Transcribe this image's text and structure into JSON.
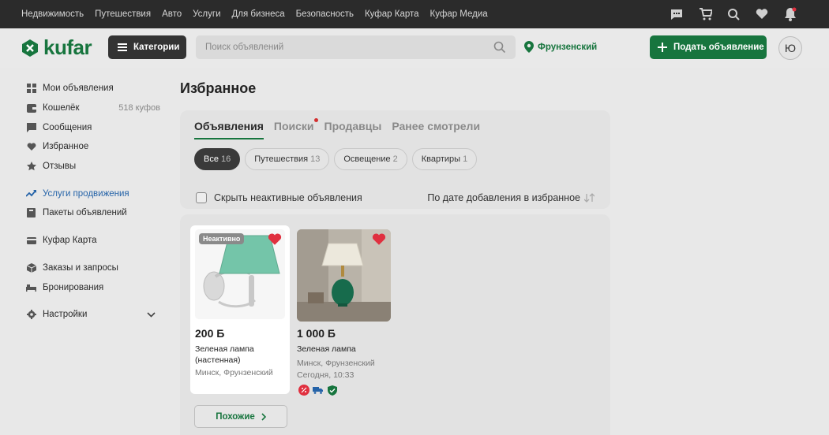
{
  "topnav": {
    "links": [
      "Недвижимость",
      "Путешествия",
      "Авто",
      "Услуги",
      "Для бизнеса",
      "Безопасность",
      "Куфар Карта",
      "Куфар Медиа"
    ],
    "icons": [
      "chat-icon",
      "cart-icon",
      "search-history-icon",
      "heart-icon",
      "bell-icon"
    ]
  },
  "header": {
    "logo_text": "kufar",
    "categories_label": "Категории",
    "search_placeholder": "Поиск объявлений",
    "region": "Фрунзенский",
    "post_button": "Подать объявление",
    "avatar_letter": "Ю"
  },
  "sidebar": {
    "items": [
      {
        "label": "Мои объявления",
        "icon": "grid-icon"
      },
      {
        "label": "Кошелёк",
        "meta": "518 куфов",
        "icon": "wallet-icon"
      },
      {
        "label": "Сообщения",
        "icon": "message-icon"
      },
      {
        "label": "Избранное",
        "icon": "heart-icon"
      },
      {
        "label": "Отзывы",
        "icon": "star-icon"
      },
      {
        "label": "Услуги продвижения",
        "icon": "trend-icon",
        "active": true
      },
      {
        "label": "Пакеты объявлений",
        "icon": "package-icon"
      },
      {
        "label": "Куфар Карта",
        "icon": "card-icon"
      },
      {
        "label": "Заказы и запросы",
        "icon": "box-icon"
      },
      {
        "label": "Бронирования",
        "icon": "bed-icon"
      },
      {
        "label": "Настройки",
        "icon": "gear-icon"
      }
    ]
  },
  "main": {
    "title": "Избранное",
    "tabs": [
      "Объявления",
      "Поиски",
      "Продавцы",
      "Ранее смотрели"
    ],
    "chips": [
      {
        "label": "Все",
        "count": "16"
      },
      {
        "label": "Путешествия",
        "count": "13"
      },
      {
        "label": "Освещение",
        "count": "2"
      },
      {
        "label": "Квартиры",
        "count": "1"
      }
    ],
    "hide_inactive": "Скрыть неактивные объявления",
    "sort_label": "По дате добавления в избранное",
    "listings": [
      {
        "badge": "Неактивно",
        "price": "200 Б",
        "title_line1": "Зеленая лампа",
        "title_line2": "(настенная)",
        "location": "Минск, Фрунзенский"
      },
      {
        "price": "1 000 Б",
        "title_line1": "Зеленая лампа",
        "location": "Минск, Фрунзенский",
        "date": "Сегодня, 10:33"
      }
    ],
    "similar_button": "Похожие"
  },
  "colors": {
    "brand": "#17753e",
    "active_link": "#2563a8",
    "heart": "#e0303f"
  }
}
